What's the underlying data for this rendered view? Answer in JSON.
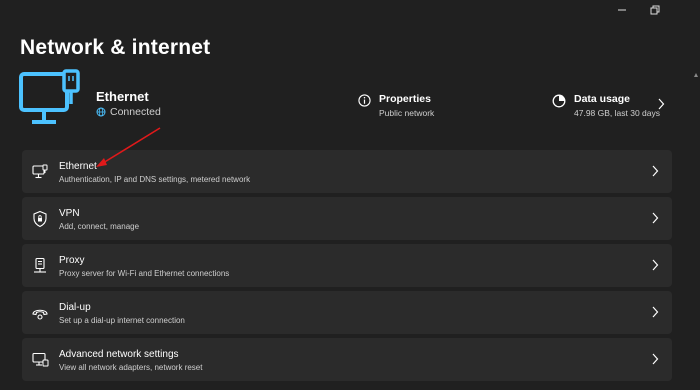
{
  "window": {
    "minimize_icon": "minimize-icon",
    "maximize_icon": "restore-icon"
  },
  "page": {
    "title": "Network & internet"
  },
  "hero": {
    "name": "Ethernet",
    "status": "Connected",
    "icon": "ethernet-monitor-icon"
  },
  "properties": {
    "title": "Properties",
    "subtitle": "Public network",
    "icon": "info-icon"
  },
  "data_usage": {
    "title": "Data usage",
    "subtitle": "47.98 GB, last 30 days",
    "icon": "data-usage-icon"
  },
  "settings": [
    {
      "title": "Ethernet",
      "subtitle": "Authentication, IP and DNS settings, metered network",
      "icon": "ethernet-icon"
    },
    {
      "title": "VPN",
      "subtitle": "Add, connect, manage",
      "icon": "shield-icon"
    },
    {
      "title": "Proxy",
      "subtitle": "Proxy server for Wi-Fi and Ethernet connections",
      "icon": "proxy-icon"
    },
    {
      "title": "Dial-up",
      "subtitle": "Set up a dial-up internet connection",
      "icon": "dial-up-icon"
    },
    {
      "title": "Advanced network settings",
      "subtitle": "View all network adapters, network reset",
      "icon": "advanced-network-icon"
    }
  ],
  "colors": {
    "background": "#202020",
    "card": "#2b2b2b",
    "accent": "#4cc2ff",
    "annotation_arrow": "#e0191a"
  }
}
